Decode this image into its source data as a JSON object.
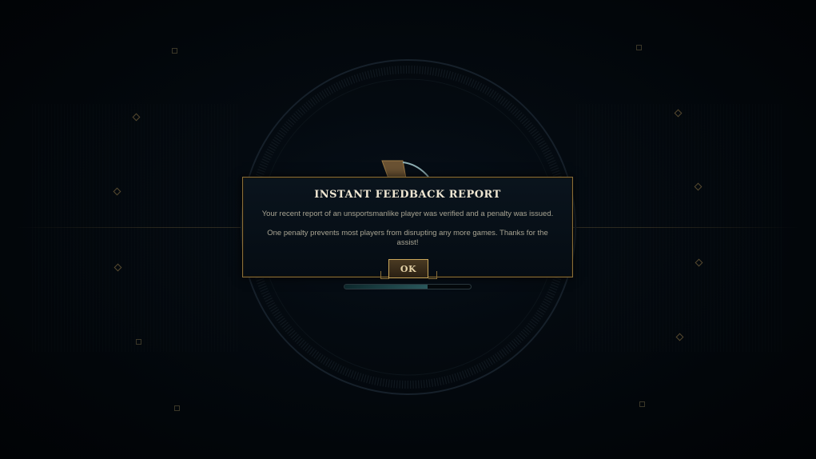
{
  "dialog": {
    "title": "INSTANT FEEDBACK REPORT",
    "message_1": "Your recent report of an unsportsmanlike player was verified and a penalty was issued.",
    "message_2": "One penalty prevents most players from disrupting any more games. Thanks for the assist!",
    "ok_label": "OK"
  },
  "progress": {
    "fraction": 0.66
  },
  "colors": {
    "gold_border": "#8a6f3a",
    "title_text": "#efe6d2",
    "body_text": "#a8a493",
    "background": "#020508"
  },
  "icons": [
    "emblem-icon",
    "sparkle-icon"
  ]
}
